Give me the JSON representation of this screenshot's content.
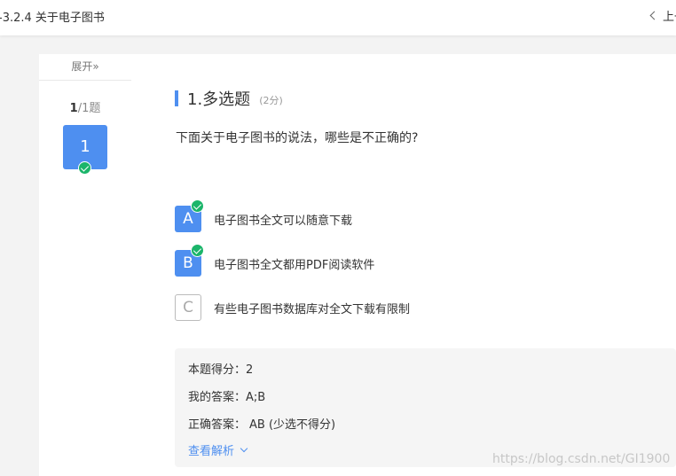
{
  "header": {
    "title": "-3.2.4 关于电子图书",
    "prev_label": "上一"
  },
  "sidebar": {
    "expand_label": "展开»",
    "counter_current": "1",
    "counter_rest": "/1题",
    "question_number": "1"
  },
  "question": {
    "title": "1.多选题",
    "score": "(2分)",
    "stem": "下面关于电子图书的说法，哪些是不正确的?",
    "options": [
      {
        "letter": "A",
        "text": "电子图书全文可以随意下载",
        "selected": true
      },
      {
        "letter": "B",
        "text": "电子图书全文都用PDF阅读软件",
        "selected": true
      },
      {
        "letter": "C",
        "text": "有些电子图书数据库对全文下载有限制",
        "selected": false
      }
    ]
  },
  "result": {
    "score_label": "本题得分：",
    "score_value": "2",
    "my_answer_label": "我的答案：",
    "my_answer_value": "A;B",
    "correct_label": "正确答案：",
    "correct_value": "AB (少选不得分)",
    "analysis_label": "查看解析"
  },
  "watermark": "https://blog.csdn.net/GI1900",
  "colors": {
    "accent": "#4e8ff0",
    "check_green": "#1bb56a",
    "page_bg": "#f3f3f3",
    "answer_bg": "#f5f5f5"
  },
  "icons": {
    "prev": "chevron-left-icon",
    "expand": "double-chevron-right-icon",
    "check": "check-circle-icon",
    "analysis": "chevron-down-icon"
  }
}
